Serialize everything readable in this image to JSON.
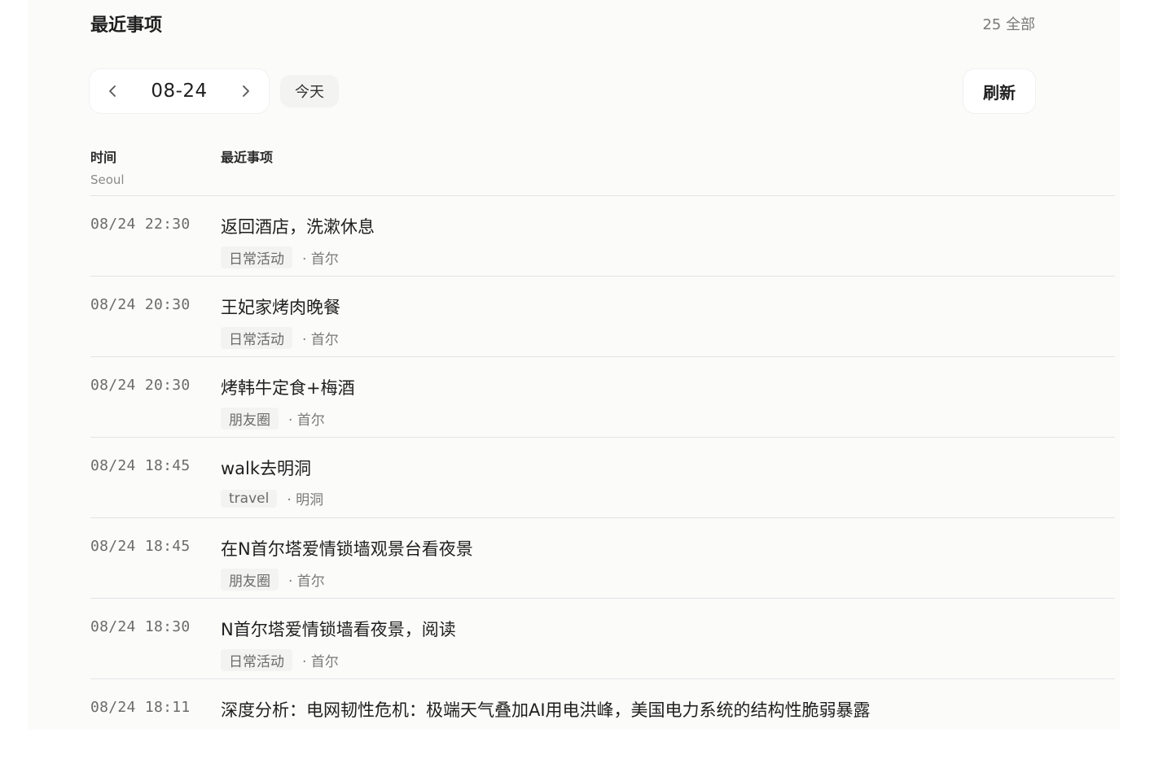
{
  "header": {
    "title": "最近事项",
    "count": "25 全部"
  },
  "toolbar": {
    "prev_icon": "chevron-left-icon",
    "current_date": "08-24",
    "next_icon": "chevron-right-icon",
    "today_label": "今天",
    "refresh_label": "刷新"
  },
  "table": {
    "time_header": "时间",
    "time_zone": "Seoul",
    "event_header": "最近事项",
    "rows": [
      {
        "time": "08/24 22:30",
        "title": "返回酒店，洗漱休息",
        "category": "日常活动",
        "location": "· 首尔"
      },
      {
        "time": "08/24 20:30",
        "title": "王妃家烤肉晚餐",
        "category": "日常活动",
        "location": "· 首尔"
      },
      {
        "time": "08/24 20:30",
        "title": "烤韩牛定食+梅酒",
        "category": "朋友圈",
        "location": "· 首尔"
      },
      {
        "time": "08/24 18:45",
        "title": "walk去明洞",
        "category": "travel",
        "location": "· 明洞"
      },
      {
        "time": "08/24 18:45",
        "title": "在N首尔塔爱情锁墙观景台看夜景",
        "category": "朋友圈",
        "location": "· 首尔"
      },
      {
        "time": "08/24 18:30",
        "title": "N首尔塔爱情锁墙看夜景，阅读",
        "category": "日常活动",
        "location": "· 首尔"
      },
      {
        "time": "08/24 18:11",
        "title": "深度分析：电网韧性危机：极端天气叠加AI用电洪峰，美国电力系统的结构性脆弱暴露",
        "category": "",
        "location": ""
      }
    ]
  }
}
